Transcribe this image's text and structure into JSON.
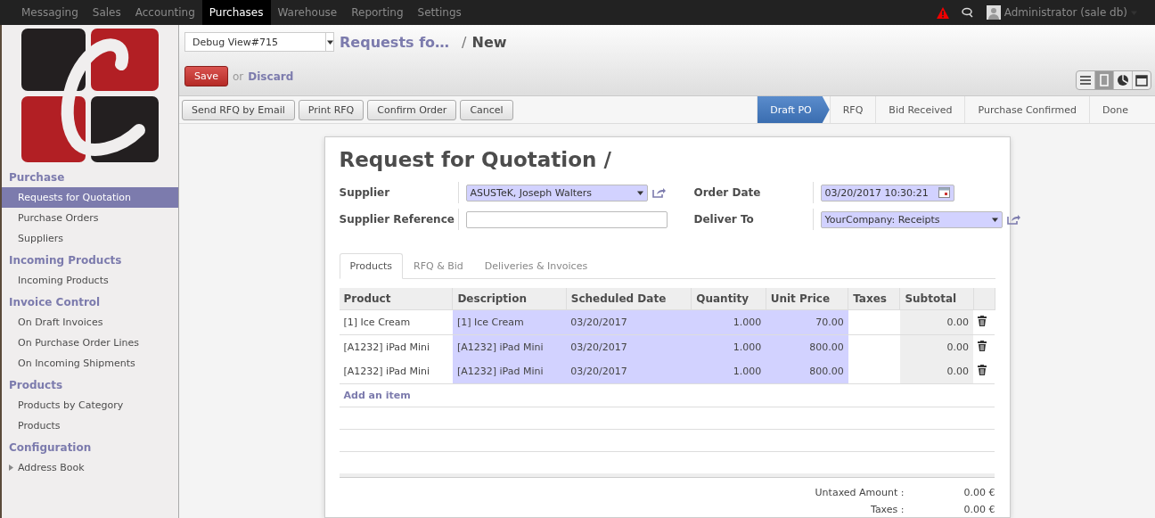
{
  "top_menu": [
    {
      "label": "Messaging",
      "selected": false
    },
    {
      "label": "Sales",
      "selected": false
    },
    {
      "label": "Accounting",
      "selected": false
    },
    {
      "label": "Purchases",
      "selected": true
    },
    {
      "label": "Warehouse",
      "selected": false
    },
    {
      "label": "Reporting",
      "selected": false
    },
    {
      "label": "Settings",
      "selected": false
    }
  ],
  "user": {
    "name": "Administrator (sale  db)"
  },
  "view_selector": {
    "value": "Debug View#715"
  },
  "breadcrumb": {
    "parent": "Requests fo…",
    "separator": "/",
    "current": "New"
  },
  "actions": {
    "save": "Save",
    "or": "or",
    "discard": "Discard"
  },
  "view_switcher": [
    {
      "kind": "list",
      "selected": false
    },
    {
      "kind": "form",
      "selected": true
    },
    {
      "kind": "graph",
      "selected": false
    },
    {
      "kind": "calendar",
      "selected": false
    }
  ],
  "sidebar": {
    "sections": [
      {
        "title": "Purchase",
        "items": [
          {
            "label": "Requests for Quotation",
            "selected": true,
            "kind": "leaf"
          },
          {
            "label": "Purchase Orders",
            "selected": false,
            "kind": "leaf"
          },
          {
            "label": "Suppliers",
            "selected": false,
            "kind": "leaf"
          }
        ]
      },
      {
        "title": "Incoming Products",
        "items": [
          {
            "label": "Incoming Products",
            "selected": false,
            "kind": "leaf"
          }
        ]
      },
      {
        "title": "Invoice Control",
        "items": [
          {
            "label": "On Draft Invoices",
            "selected": false,
            "kind": "leaf"
          },
          {
            "label": "On Purchase Order Lines",
            "selected": false,
            "kind": "leaf"
          },
          {
            "label": "On Incoming Shipments",
            "selected": false,
            "kind": "leaf"
          }
        ]
      },
      {
        "title": "Products",
        "items": [
          {
            "label": "Products by Category",
            "selected": false,
            "kind": "leaf"
          },
          {
            "label": "Products",
            "selected": false,
            "kind": "leaf"
          }
        ]
      },
      {
        "title": "Configuration",
        "items": [
          {
            "label": "Address Book",
            "selected": false,
            "kind": "folder"
          }
        ]
      }
    ]
  },
  "toolbar_buttons": [
    "Send RFQ by Email",
    "Print RFQ",
    "Confirm Order",
    "Cancel"
  ],
  "status_steps": [
    {
      "label": "Draft PO",
      "selected": true
    },
    {
      "label": "RFQ",
      "selected": false
    },
    {
      "label": "Bid Received",
      "selected": false
    },
    {
      "label": "Purchase Confirmed",
      "selected": false
    },
    {
      "label": "Done",
      "selected": false
    }
  ],
  "form": {
    "title": "Request for Quotation /",
    "fields_left": [
      {
        "label": "Supplier",
        "kind": "select",
        "value": "ASUSTeK, Joseph Walters",
        "required": true,
        "external_link": true
      },
      {
        "label": "Supplier Reference",
        "kind": "text",
        "required": false,
        "external_link": false
      }
    ],
    "fields_right": [
      {
        "label": "Order Date",
        "kind": "datetime",
        "value": "03/20/2017 10:30:21",
        "required": true,
        "external_link": false
      },
      {
        "label": "Deliver To",
        "kind": "select",
        "value": "YourCompany: Receipts",
        "required": true,
        "external_link": true
      }
    ],
    "tabs": [
      {
        "label": "Products",
        "selected": true
      },
      {
        "label": "RFQ & Bid",
        "selected": false
      },
      {
        "label": "Deliveries & Invoices",
        "selected": false
      }
    ],
    "table": {
      "columns": [
        {
          "label": "Product",
          "kind": "normal",
          "numeric": false
        },
        {
          "label": "Description",
          "kind": "required",
          "numeric": false
        },
        {
          "label": "Scheduled Date",
          "kind": "required",
          "numeric": false
        },
        {
          "label": "Quantity",
          "kind": "required",
          "numeric": true
        },
        {
          "label": "Unit Price",
          "kind": "required",
          "numeric": true
        },
        {
          "label": "Taxes",
          "kind": "normal"
        },
        {
          "label": "Subtotal",
          "kind": "readonly",
          "numeric": true
        }
      ],
      "rows": [
        {
          "cells": [
            "[1] Ice Cream",
            "[1] Ice Cream",
            "03/20/2017",
            "1.000",
            "70.00",
            "",
            "0.00"
          ]
        },
        {
          "cells": [
            "[A1232] iPad Mini",
            "[A1232] iPad Mini",
            "03/20/2017",
            "1.000",
            "800.00",
            "",
            "0.00"
          ]
        },
        {
          "cells": [
            "[A1232] iPad Mini",
            "[A1232] iPad Mini",
            "03/20/2017",
            "1.000",
            "800.00",
            "",
            "0.00"
          ]
        }
      ],
      "add_item": "Add an item"
    },
    "totals": [
      {
        "label": "Untaxed Amount :",
        "value": "0.00 €"
      },
      {
        "label": "Taxes :",
        "value": "0.00 €"
      }
    ]
  }
}
